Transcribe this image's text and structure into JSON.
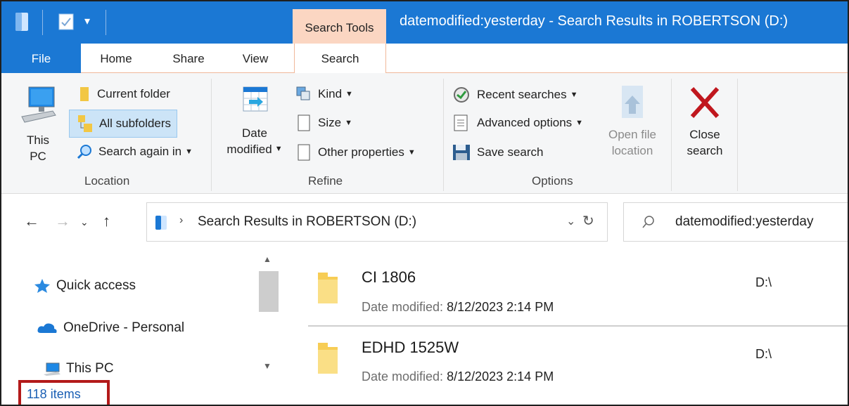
{
  "window": {
    "contextual_tab": "Search Tools",
    "title": "datemodified:yesterday - Search Results in ROBERTSON (D:)"
  },
  "tabs": [
    "File",
    "Home",
    "Share",
    "View",
    "Search"
  ],
  "ribbon": {
    "location": {
      "label": "Location",
      "this_pc": [
        "This",
        "PC"
      ],
      "current_folder": "Current folder",
      "all_subfolders": "All subfolders",
      "search_again_in": "Search again in"
    },
    "refine": {
      "label": "Refine",
      "date_modified": [
        "Date",
        "modified"
      ],
      "kind": "Kind",
      "size": "Size",
      "other_properties": "Other properties"
    },
    "options": {
      "label": "Options",
      "recent_searches": "Recent searches",
      "advanced_options": "Advanced options",
      "save_search": "Save search",
      "open_file_location": [
        "Open file",
        "location"
      ],
      "close_search": [
        "Close",
        "search"
      ]
    }
  },
  "address_bar": {
    "path": "Search Results in ROBERTSON (D:)",
    "search_value": "datemodified:yesterday"
  },
  "nav_pane": {
    "items": [
      "Quick access",
      "OneDrive - Personal",
      "This PC"
    ]
  },
  "results": [
    {
      "name": "CI 1806",
      "date_label": "Date modified:",
      "date": "8/12/2023 2:14 PM",
      "location": "D:\\"
    },
    {
      "name": "EDHD 1525W",
      "date_label": "Date modified:",
      "date": "8/12/2023 2:14 PM",
      "location": "D:\\"
    }
  ],
  "status": {
    "item_count": "118 items"
  },
  "colors": {
    "accent": "#1b78d4",
    "contextual": "#fbd6c2",
    "highlight_box": "#b31a1a",
    "close_x": "#c0171e"
  }
}
